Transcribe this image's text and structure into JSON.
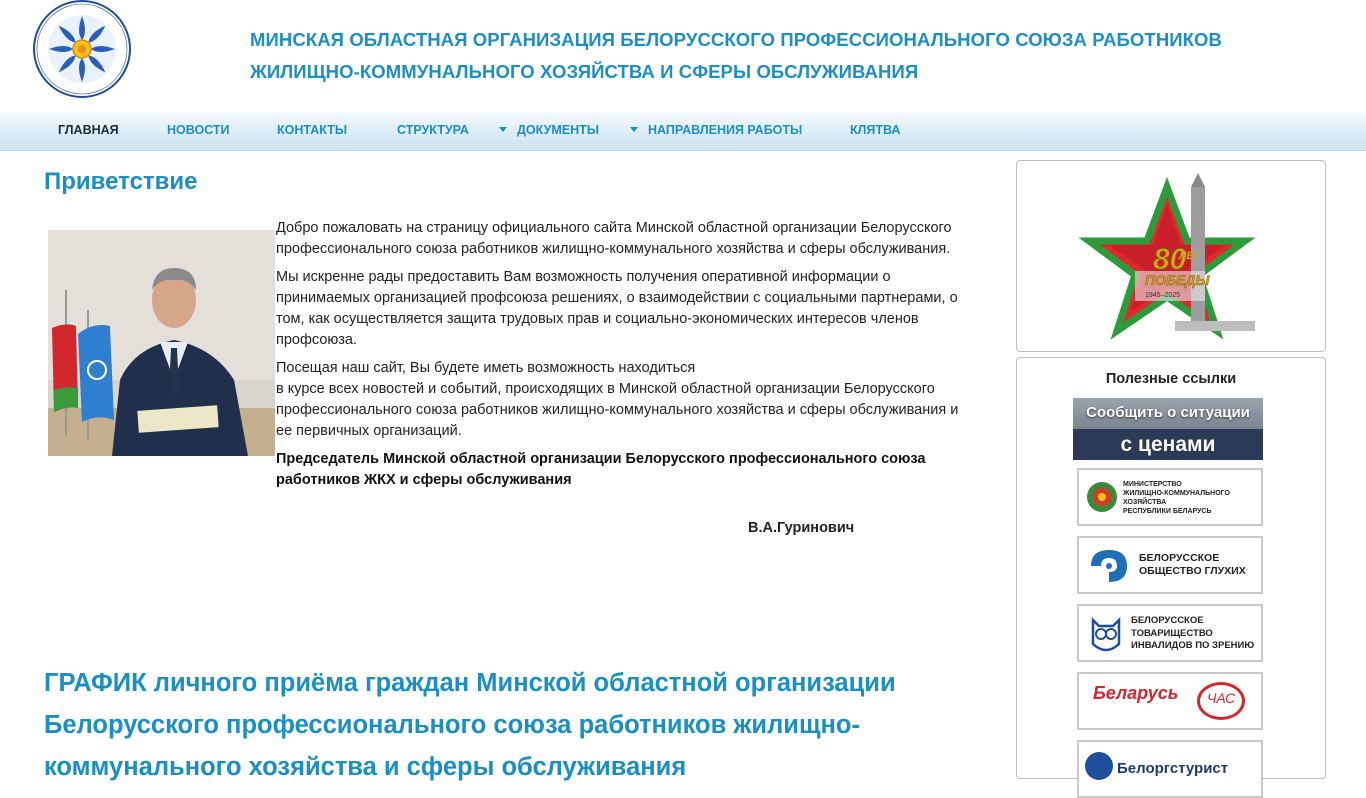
{
  "header": {
    "title_line1": "МИНСКАЯ ОБЛАСТНАЯ ОРГАНИЗАЦИЯ БЕЛОРУССКОГО ПРОФЕССИОНАЛЬНОГО СОЮЗА РАБОТНИКОВ",
    "title_line2": "ЖИЛИЩНО-КОММУНАЛЬНОГО ХОЗЯЙСТВА И СФЕРЫ ОБСЛУЖИВАНИЯ"
  },
  "nav": {
    "items": [
      {
        "label": "ГЛАВНАЯ",
        "active": true,
        "dropdown": false
      },
      {
        "label": "НОВОСТИ",
        "active": false,
        "dropdown": false
      },
      {
        "label": "КОНТАКТЫ",
        "active": false,
        "dropdown": false
      },
      {
        "label": "СТРУКТУРА",
        "active": false,
        "dropdown": false
      },
      {
        "label": "ДОКУМЕНТЫ",
        "active": false,
        "dropdown": true
      },
      {
        "label": "НАПРАВЛЕНИЯ РАБОТЫ",
        "active": false,
        "dropdown": true
      },
      {
        "label": "КЛЯТВА",
        "active": false,
        "dropdown": false
      }
    ]
  },
  "greeting": {
    "title": "Приветствие",
    "paragraph1": "Добро пожаловать на страницу официального сайта Минской областной организации Белорусского профессионального союза работников жилищно-коммунального хозяйства и сферы обслуживания.",
    "paragraph2": "Мы  искренне рады  предоставить Вам возможность  получения оперативной информации о принимаемых  организацией профсоюза решениях, о взаимодействии с социальными партнерами, о том, как  осуществляется защита трудовых прав и социально-экономических интересов членов профсоюза.",
    "paragraph3_line1": "Посещая  наш  сайт,  Вы будете иметь возможность находиться",
    "paragraph3_rest": "в курсе всех новостей и событий, происходящих в Минской областной организации Белорусского профессионального союза работников жилищно-коммунального хозяйства и сферы обслуживания и ее первичных организаций.",
    "chairman_title": "Председатель Минской областной организации Белорусского профессионального союза работников ЖКХ и сферы обслуживания",
    "signature": "В.А.Гуринович"
  },
  "schedule": {
    "title": "ГРАФИК личного приёма граждан Минской областной организации Белорусского профессионального союза работников жилищно-коммунального хозяйства и сферы обслуживания"
  },
  "sidebar": {
    "victory_banner": {
      "number": "80",
      "word_top": "ЛЕТ",
      "word_bottom": "ПОБЕДЫ",
      "years": "1945–2025"
    },
    "useful_links_title": "Полезные ссылки",
    "report_banner": {
      "line1": "Сообщить о ситуации",
      "line2": "с ценами"
    },
    "links": [
      {
        "line1": "МИНИСТЕРСТВО",
        "line2": "ЖИЛИЩНО-КОММУНАЛЬНОГО ХОЗЯЙСТВА",
        "line3": "РЕСПУБЛИКИ БЕЛАРУСЬ"
      },
      {
        "line1": "БЕЛОРУССКОЕ",
        "line2": "ОБЩЕСТВО ГЛУХИХ"
      },
      {
        "line1": "БЕЛОРУССКОЕ",
        "line2": "ТОВАРИЩЕСТВО",
        "line3": "ИНВАЛИДОВ ПО ЗРЕНИЮ"
      },
      {
        "line1": "Беларусь",
        "line2": "ЧАС"
      },
      {
        "line1": "Белоргстурист"
      }
    ]
  },
  "colors": {
    "accent": "#1a8fc6",
    "text": "#222222",
    "nav_bg": "#dcecf6"
  }
}
